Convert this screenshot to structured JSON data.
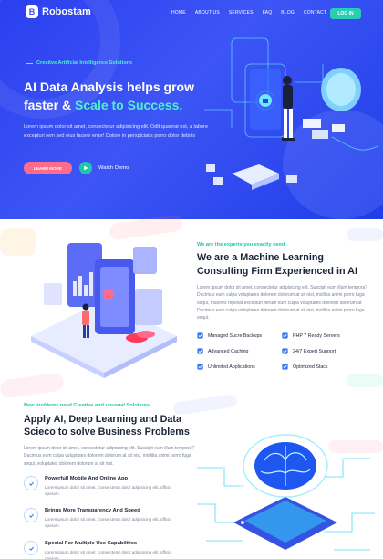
{
  "brand": {
    "name": "Robostam",
    "mark": "B"
  },
  "nav": {
    "items": [
      "HOME",
      "ABOUT US",
      "SERVICES",
      "FAQ",
      "BLOG",
      "CONTACT"
    ],
    "login": "LOG IN"
  },
  "hero": {
    "eyebrow": "Creative Artificial Intelligence Solutions",
    "title_line1": "AI Data Analysis helps grow",
    "title_line2_prefix": "faster & ",
    "title_line2_accent": "Scale to Success.",
    "text": "Lorem ipsum dolor sit amet, consectetur adipisicing elit. Odit quaerat est, a labore excepturi rem sed eius facere error! Dolore in perspiciatis porro dolor debitis",
    "cta_primary": "LEARN MORE",
    "cta_secondary": "Watch Demo"
  },
  "about": {
    "eyebrow": "We are the experts you exactly need",
    "title_line1": "We are a Machine Learning",
    "title_line2": "Consulting Firm Experienced in AI",
    "text": "Lorem ipsum dolor sit amet, consectetur adipisicing elit. Suscipit eum illum tempora? Ducimus eum culpa voluptates dolorem dolorum at sit nisi, mollitia animi porro fuga sequi, maiores repellat excepturi iterum eum culpa voluptates dolorem dolorum at Ducimus eum culpa voluptates dolorem dolorum at sit nisi, mollitia animi porro fuga sequi.",
    "features": [
      "Managed Sucre Backups",
      "PHP 7 Ready Servers",
      "Advanced Caching",
      "24/7 Expert Support",
      "Unlimited Applications",
      "Optimized Stack"
    ]
  },
  "solve": {
    "eyebrow": "New problems need Creative and unusual Solutions",
    "title_line1": "Apply AI, Deep Learning and Data",
    "title_line2": "Scieco to solve Business Problems",
    "text": "Lorem ipsum dolor sit amet, consectetur adipisicing elit. Suscipit eum illum tempora? Ducimus eum culpa voluptates dolorem dolorum at sit nisi, mollitia animi porro fuga sequi, voluptates dolorem dolorum at sit nisi.",
    "items": [
      {
        "title": "Powerfull Mobile And Online App",
        "text": "Lorem ipsum dolor sit amet, conse ctetur dolor adipisicing elit. officia operam."
      },
      {
        "title": "Brings More Transparency And Speed",
        "text": "Lorem ipsum dolor sit amet, conse ctetur dolor adipisicing elit. officia operam."
      },
      {
        "title": "Special For Multiple Use Capabilities",
        "text": "Lorem ipsum dolor sit amet, conse ctetur dolor adipisicing elit. officia operam."
      }
    ]
  },
  "colors": {
    "hero_bg": "#2f46f2",
    "accent_teal": "#4ff0d0",
    "cta_pink": "#ff6b8b",
    "login_green": "#29cdb1",
    "check_blue": "#3a78f0"
  }
}
